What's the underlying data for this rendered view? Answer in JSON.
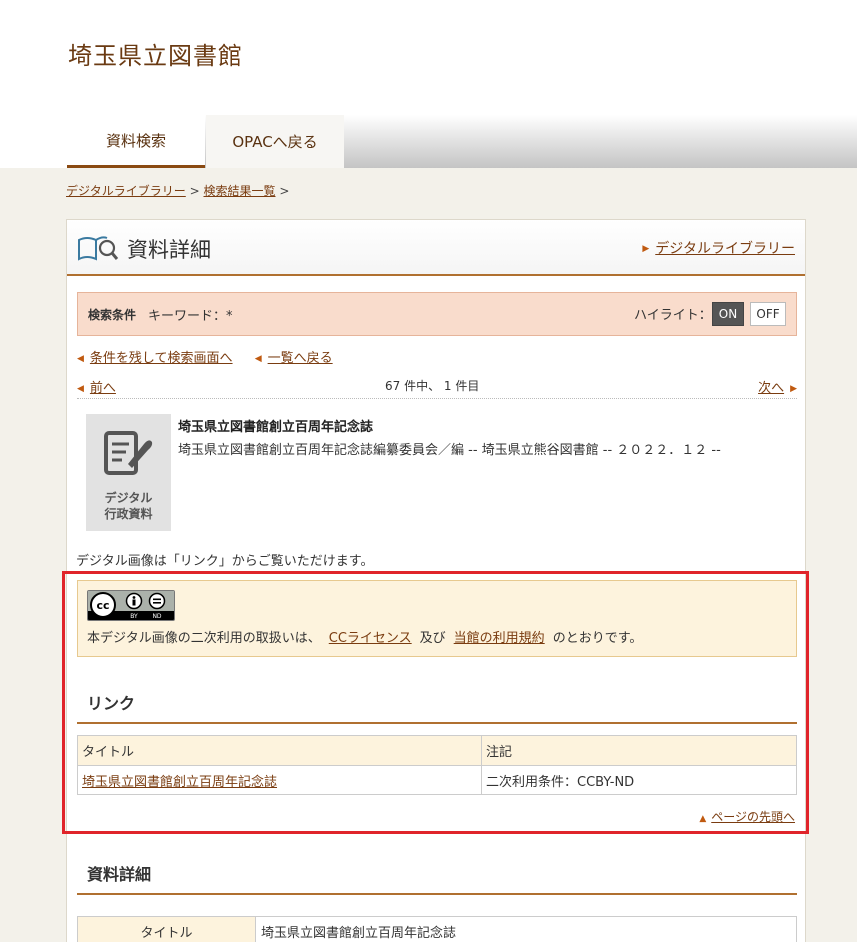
{
  "site": {
    "title": "埼玉県立図書館"
  },
  "tabs": [
    {
      "label": "資料検索"
    },
    {
      "label": "OPACへ戻る"
    }
  ],
  "breadcrumb": {
    "item1": "デジタルライブラリー",
    "sep": ">",
    "item2": "検索結果一覧"
  },
  "panel": {
    "title": "資料詳細",
    "link": "デジタルライブラリー"
  },
  "conditions": {
    "label": "検索条件",
    "keyword": "キーワード：*",
    "highlight_label": "ハイライト：",
    "on": "ON",
    "off": "OFF"
  },
  "nav": {
    "back_search": "条件を残して検索画面へ",
    "back_list": "一覧へ戻る",
    "prev": "前へ",
    "count": "67 件中、 1 件目",
    "next": "次へ"
  },
  "item": {
    "thumb_line1": "デジタル",
    "thumb_line2": "行政資料",
    "title": "埼玉県立図書館創立百周年記念誌",
    "meta": "埼玉県立図書館創立百周年記念誌編纂委員会／編 -- 埼玉県立熊谷図書館 -- ２０２２．１２ --"
  },
  "link_note": "デジタル画像は「リンク」からご覧いただけます。",
  "license": {
    "badge_cc": "cc",
    "badge_by": "BY",
    "badge_nd": "ND",
    "text_before": "本デジタル画像の二次利用の取扱いは、",
    "link1": "CCライセンス",
    "mid": "及び",
    "link2": "当館の利用規約",
    "text_after": "のとおりです。"
  },
  "links_section": {
    "heading": "リンク",
    "columns": [
      "タイトル",
      "注記"
    ],
    "rows": [
      {
        "title": "埼玉県立図書館創立百周年記念誌",
        "note": "二次利用条件：CCBY-ND"
      }
    ],
    "page_top": "ページの先頭へ"
  },
  "details_section": {
    "heading": "資料詳細",
    "rows": [
      {
        "label": "タイトル",
        "value": "埼玉県立図書館創立百周年記念誌"
      }
    ]
  },
  "colors": {
    "brown": "#7a3c10",
    "accent_orange": "#c05a10",
    "highlight_red": "#e0242a"
  }
}
